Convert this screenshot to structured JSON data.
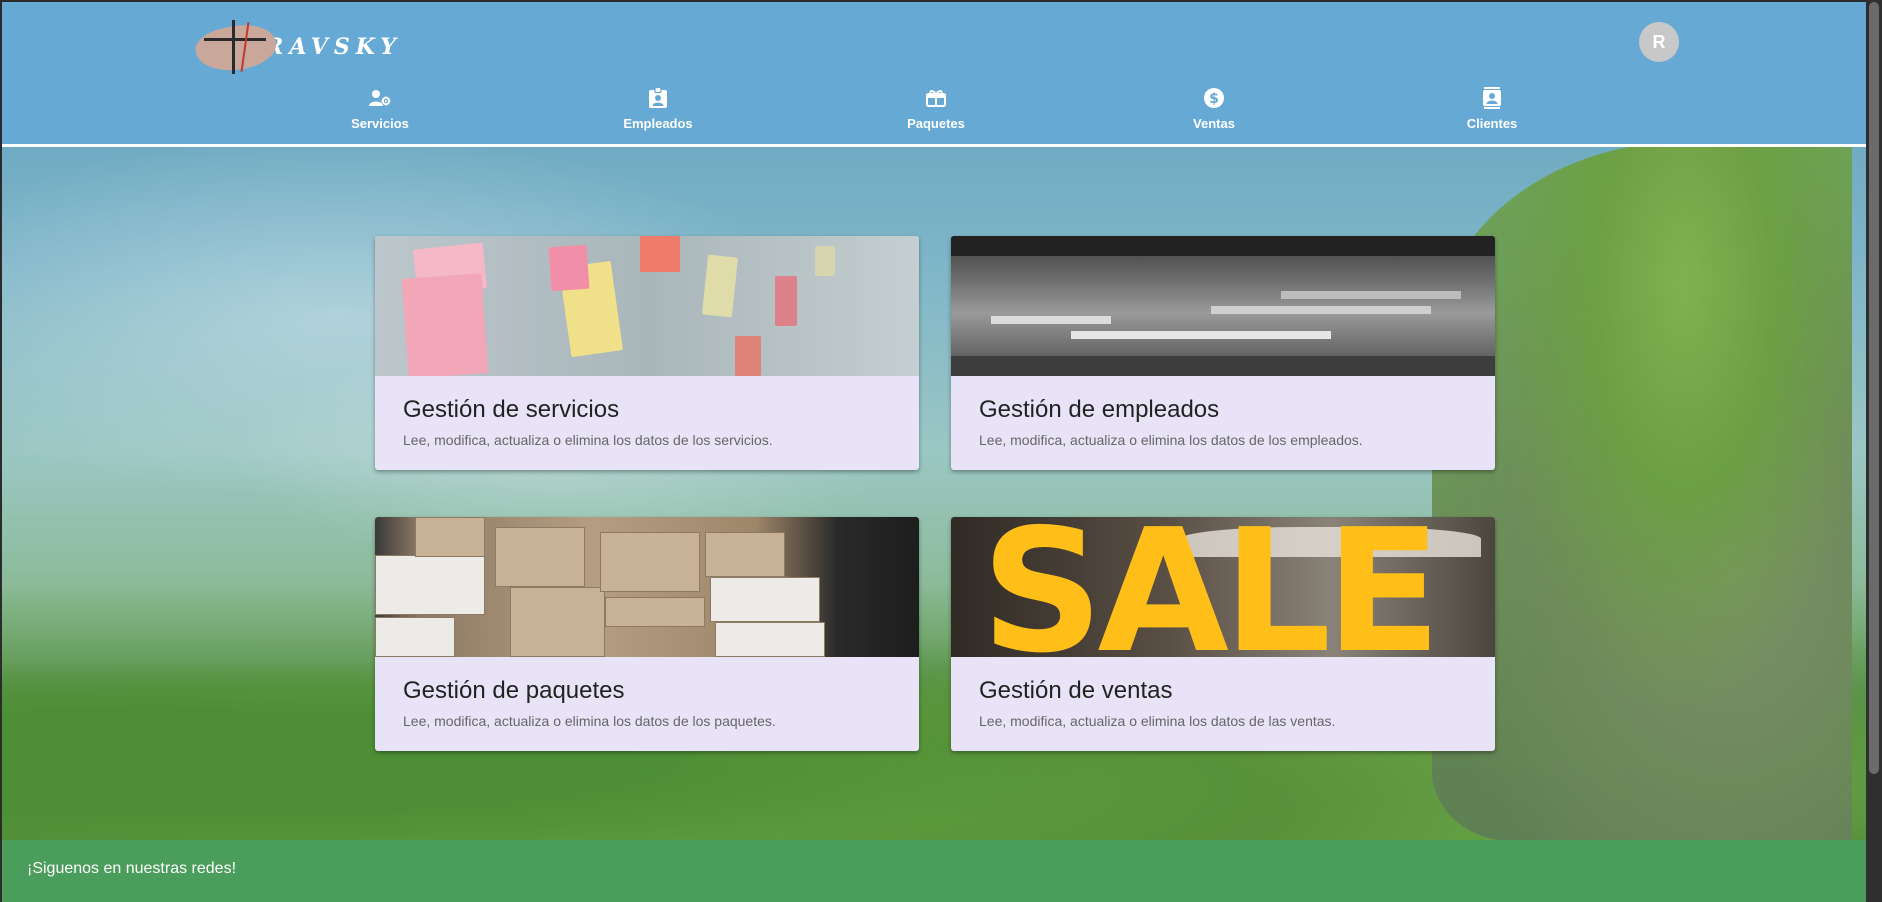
{
  "brand": {
    "name": "TRAVSKY"
  },
  "user": {
    "avatar_initial": "R"
  },
  "nav": {
    "items": [
      {
        "label": "Servicios",
        "icon": "user-gear-icon"
      },
      {
        "label": "Empleados",
        "icon": "id-badge-icon"
      },
      {
        "label": "Paquetes",
        "icon": "gift-box-icon"
      },
      {
        "label": "Ventas",
        "icon": "dollar-circle-icon"
      },
      {
        "label": "Clientes",
        "icon": "contact-book-icon"
      }
    ]
  },
  "cards": [
    {
      "title": "Gestión de servicios",
      "description": "Lee, modifica, actualiza o elimina los datos de los servicios.",
      "image": "sticky-notes-image"
    },
    {
      "title": "Gestión de empleados",
      "description": "Lee, modifica, actualiza o elimina los datos de los empleados.",
      "image": "open-office-image"
    },
    {
      "title": "Gestión de paquetes",
      "description": "Lee, modifica, actualiza o elimina los datos de los paquetes.",
      "image": "cardboard-boxes-image"
    },
    {
      "title": "Gestión de ventas",
      "description": "Lee, modifica, actualiza o elimina los datos de las ventas.",
      "image": "sale-sign-image"
    }
  ],
  "sale_sign_text": "SALE",
  "footer": {
    "text": "¡Siguenos en nuestras redes!"
  },
  "colors": {
    "header": "#65a9d4",
    "card": "#e9e3f8",
    "footer": "#4a9d5a",
    "avatar": "#c8c8c8"
  }
}
